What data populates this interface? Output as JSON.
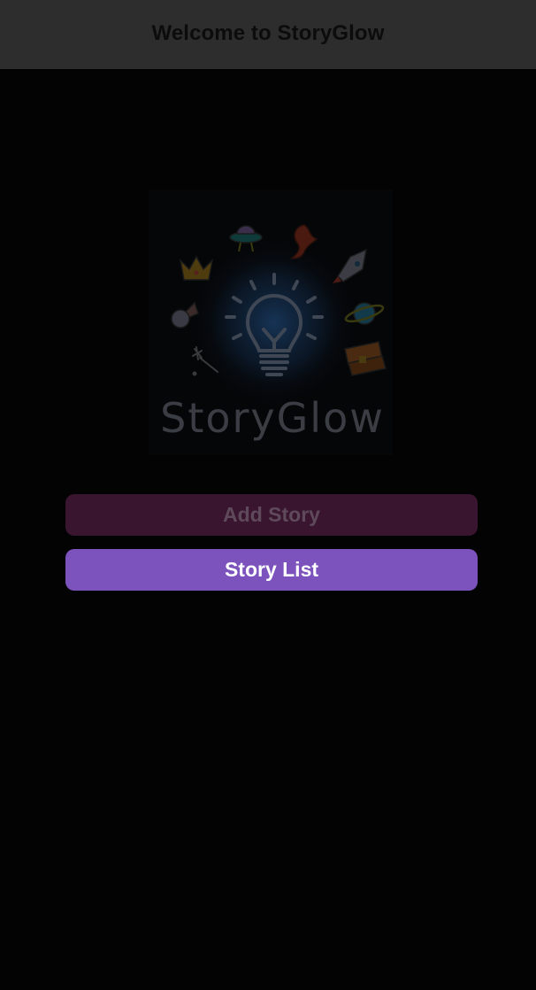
{
  "nav": {
    "title": "Welcome to StoryGlow"
  },
  "logo": {
    "wordmark": "StoryGlow",
    "icons": [
      "lightbulb-icon",
      "crown-icon",
      "ufo-icon",
      "seahorse-icon",
      "rocket-icon",
      "planet-icon",
      "ice-cream-icon",
      "magic-wand-icon",
      "treasure-chest-icon"
    ]
  },
  "actions": {
    "add_story_label": "Add Story",
    "story_list_label": "Story List"
  },
  "colors": {
    "nav_background": "#2d2d2d",
    "background": "#030303",
    "add_story_button": "#3a1530",
    "story_list_button": "#7c52bd"
  }
}
